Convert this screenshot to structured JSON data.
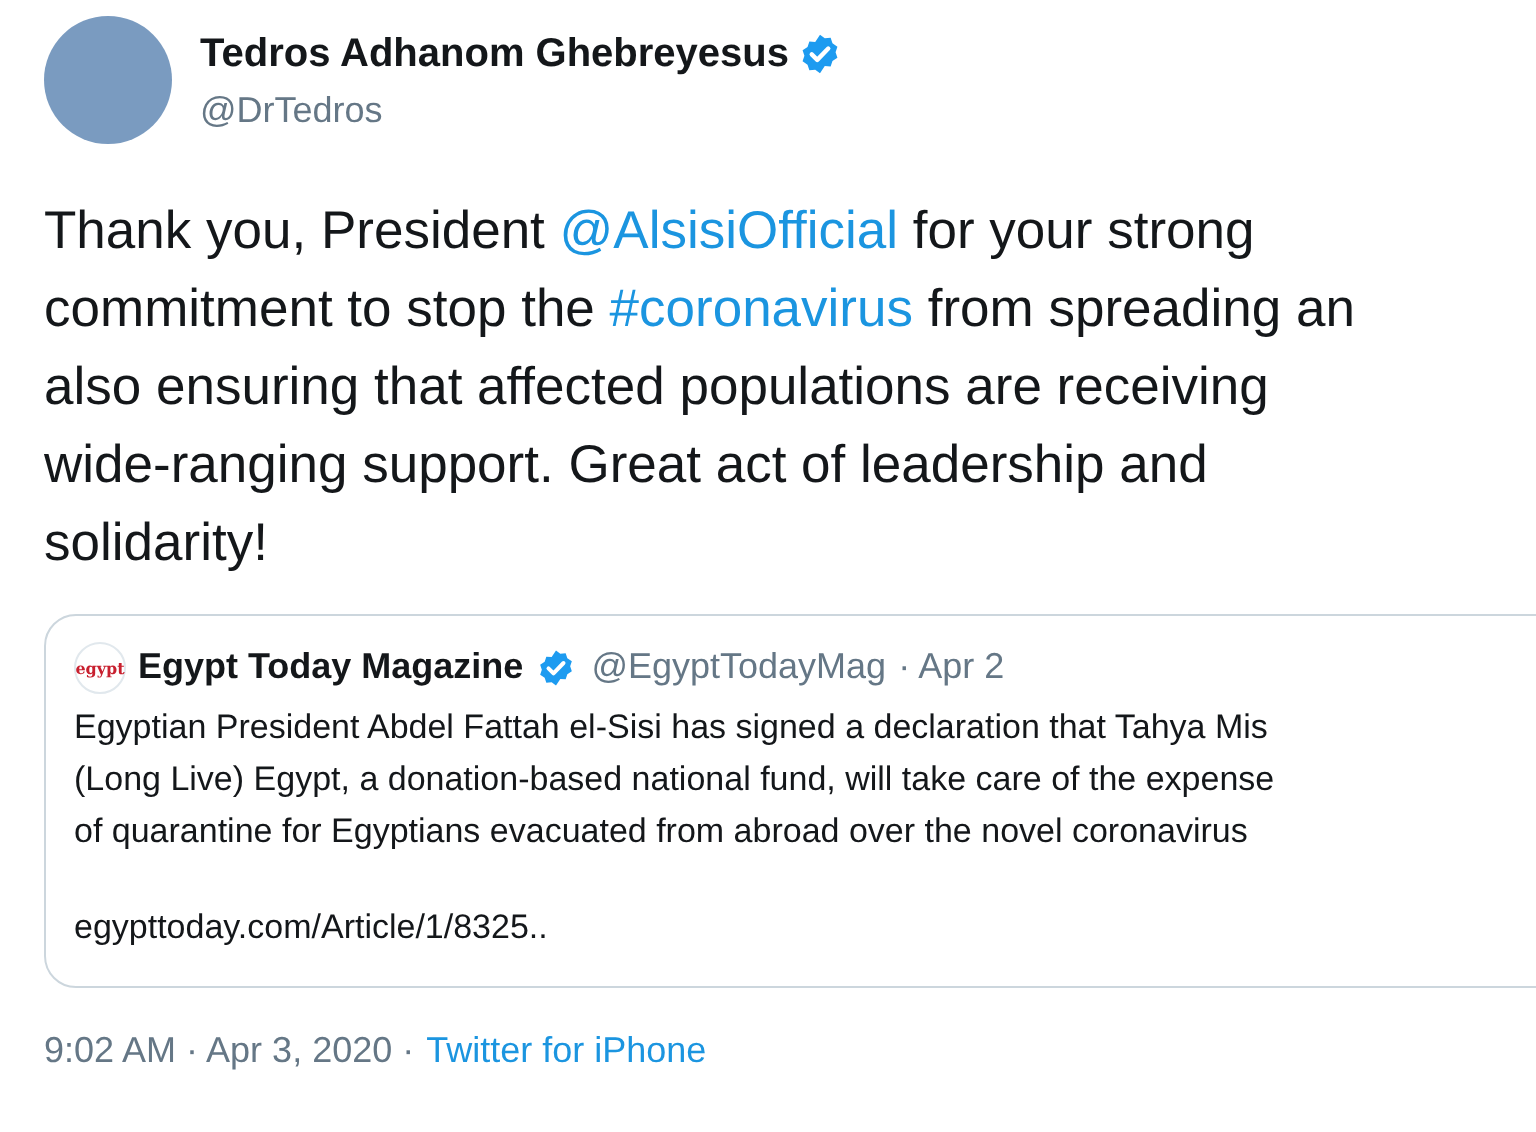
{
  "author": {
    "name": "Tedros Adhanom Ghebreyesus",
    "handle": "@DrTedros",
    "verified": true
  },
  "body": [
    [
      {
        "kind": "text",
        "text": "Thank you, President "
      },
      {
        "kind": "mention",
        "text": "@AlsisiOfficial"
      },
      {
        "kind": "text",
        "text": " for your strong"
      }
    ],
    [
      {
        "kind": "text",
        "text": "commitment to stop the "
      },
      {
        "kind": "hashtag",
        "text": "#coronavirus"
      },
      {
        "kind": "text",
        "text": " from spreading an"
      }
    ],
    [
      {
        "kind": "text",
        "text": "also ensuring that affected populations are receiving"
      }
    ],
    [
      {
        "kind": "text",
        "text": "wide-ranging support. Great act of leadership and"
      }
    ],
    [
      {
        "kind": "text",
        "text": "solidarity!"
      }
    ]
  ],
  "quoted": {
    "logo_text": "egypt",
    "name": "Egypt Today Magazine",
    "verified": true,
    "handle": "@EgyptTodayMag",
    "date": "· Apr 2",
    "lines": [
      "Egyptian President Abdel Fattah el-Sisi has signed a declaration that Tahya Mis",
      "(Long Live) Egypt, a donation-based national fund, will take care of the expense",
      "of quarantine for Egyptians evacuated from abroad over the novel coronavirus"
    ],
    "link": "egypttoday.com/Article/1/8325.."
  },
  "footer": {
    "time": "9:02 AM · Apr 3, 2020 ·",
    "source": "Twitter for iPhone"
  }
}
